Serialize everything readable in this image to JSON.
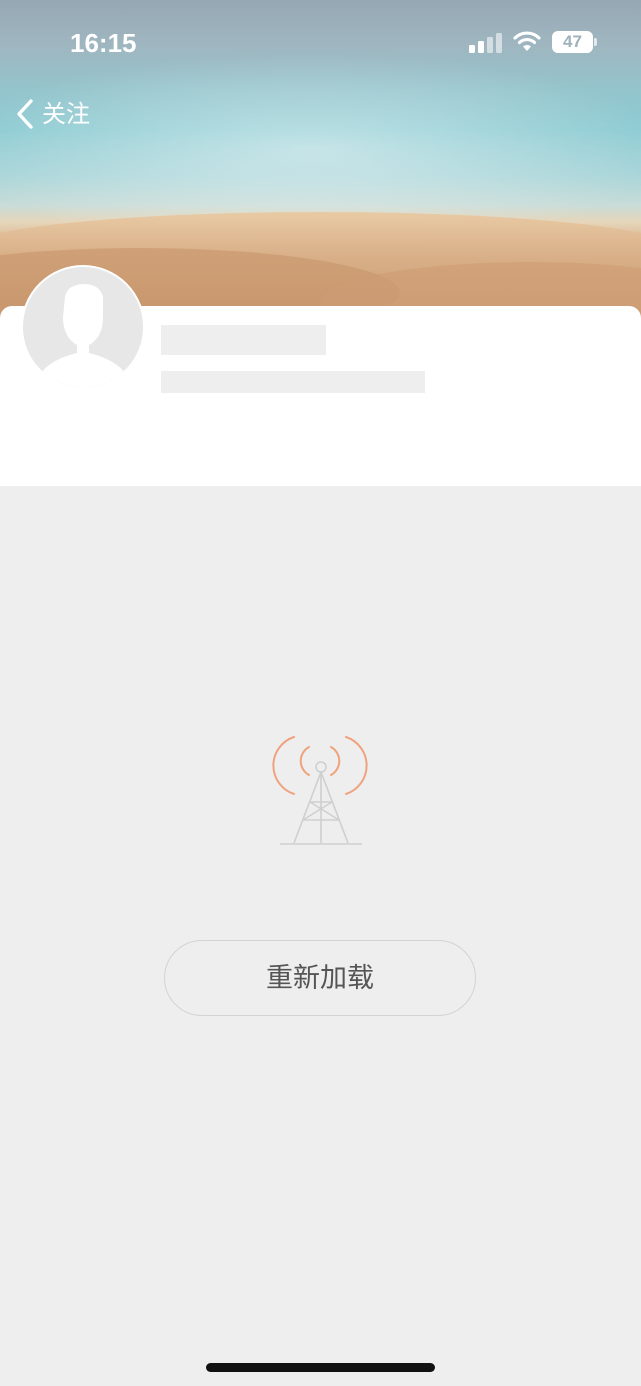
{
  "status_bar": {
    "time": "16:15",
    "battery_level": "47",
    "signal_icon": "cellular-signal-icon",
    "wifi_icon": "wifi-icon",
    "battery_icon": "battery-icon"
  },
  "nav": {
    "back_icon": "chevron-left-icon",
    "back_label": "关注"
  },
  "profile": {
    "avatar_icon": "default-avatar-icon",
    "name": "",
    "bio": ""
  },
  "error_state": {
    "icon": "signal-tower-icon",
    "message": "",
    "reload_button_label": "重新加载"
  },
  "colors": {
    "page_background": "#eeeeee",
    "card_background": "#ffffff",
    "placeholder": "#eeeeee",
    "accent_orange": "#f0a27e",
    "tower_gray": "#cfcfcf",
    "button_border": "#d3d3d3",
    "button_text": "#555555"
  }
}
